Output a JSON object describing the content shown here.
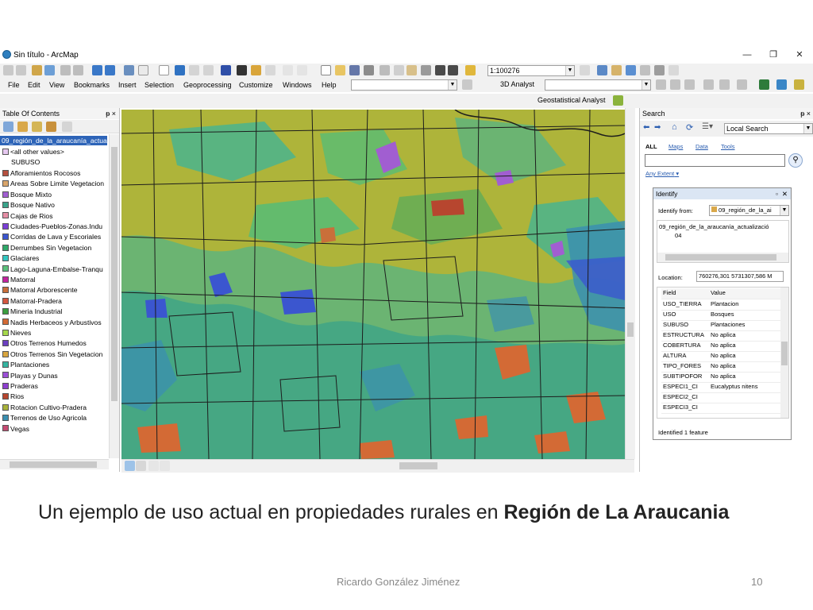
{
  "window": {
    "title": "Sin título - ArcMap",
    "minimize": "—",
    "restore": "❐",
    "close": "✕"
  },
  "toolbar": {
    "scale": "1:100276",
    "analyst_3d": "3D Analyst",
    "geostat": "Geostatistical Analyst"
  },
  "menu": [
    "File",
    "Edit",
    "View",
    "Bookmarks",
    "Insert",
    "Selection",
    "Geoprocessing",
    "Customize",
    "Windows",
    "Help"
  ],
  "toc": {
    "title": "Table Of Contents",
    "pin": "ᵽ ×",
    "layer": "09_región_de_la_araucanía_actual",
    "all_other": "<all other values>",
    "field": "SUBUSO",
    "classes": [
      {
        "label": "Afloramientos Rocosos",
        "color": "#b5503f"
      },
      {
        "label": "Areas Sobre Limite Vegetacion",
        "color": "#d9a56b"
      },
      {
        "label": "Bosque Mixto",
        "color": "#a15ed1"
      },
      {
        "label": "Bosque Nativo",
        "color": "#3aa38a"
      },
      {
        "label": "Cajas de Rios",
        "color": "#e58ea5"
      },
      {
        "label": "Ciudades-Pueblos-Zonas.Indu",
        "color": "#7a3fd6"
      },
      {
        "label": "Corridas de Lava y Escoriales",
        "color": "#3b56cf"
      },
      {
        "label": "Derrumbes Sin Vegetacion",
        "color": "#2fa86a"
      },
      {
        "label": "Glaciares",
        "color": "#33c6c0"
      },
      {
        "label": "Lago-Laguna-Embalse-Tranqu",
        "color": "#5bc07c"
      },
      {
        "label": "Matorral",
        "color": "#c3249e"
      },
      {
        "label": "Matorral Arborescente",
        "color": "#c96f3a"
      },
      {
        "label": "Matorral-Pradera",
        "color": "#d4563f"
      },
      {
        "label": "Mineria Industrial",
        "color": "#3a9e3f"
      },
      {
        "label": "Nadis Herbaceos y Arbustivos",
        "color": "#d36a35"
      },
      {
        "label": "Nieves",
        "color": "#a5d84a"
      },
      {
        "label": "Otros Terrenos Humedos",
        "color": "#6b3fc0"
      },
      {
        "label": "Otros Terrenos Sin Vegetacion",
        "color": "#d8a53f"
      },
      {
        "label": "Plantaciones",
        "color": "#35b4a0"
      },
      {
        "label": "Playas y Dunas",
        "color": "#9b4fd6"
      },
      {
        "label": "Praderas",
        "color": "#8e3fcf"
      },
      {
        "label": "Rios",
        "color": "#b7462f"
      },
      {
        "label": "Rotacion Cultivo-Pradera",
        "color": "#a8b23a"
      },
      {
        "label": "Terrenos de Uso Agricola",
        "color": "#3b8fb0"
      },
      {
        "label": "Vegas",
        "color": "#c54b72"
      }
    ]
  },
  "search": {
    "title": "Search",
    "pin": "ᵽ ×",
    "scope": "Local Search",
    "tabs": [
      "ALL",
      "Maps",
      "Data",
      "Tools"
    ],
    "any_extent": "Any Extent"
  },
  "identify": {
    "title": "Identify",
    "from_label": "Identify from:",
    "from_value": "09_región_de_la_ai",
    "tree_layer": "09_región_de_la_araucanía_actualizació",
    "tree_item": "04",
    "location_label": "Location:",
    "location_value": "760276,301  5731307,586 M",
    "col_field": "Field",
    "col_value": "Value",
    "rows": [
      {
        "field": "USO_TIERRA",
        "value": "Plantacion"
      },
      {
        "field": "USO",
        "value": "Bosques"
      },
      {
        "field": "SUBUSO",
        "value": "Plantaciones"
      },
      {
        "field": "ESTRUCTURA",
        "value": "No aplica"
      },
      {
        "field": "COBERTURA",
        "value": "No aplica"
      },
      {
        "field": "ALTURA",
        "value": "No aplica"
      },
      {
        "field": "TIPO_FORES",
        "value": "No aplica"
      },
      {
        "field": "SUBTIPOFOR",
        "value": "No aplica"
      },
      {
        "field": "ESPECI1_CI",
        "value": "Eucalyptus nitens"
      },
      {
        "field": "ESPECI2_CI",
        "value": ""
      },
      {
        "field": "ESPECI3_CI",
        "value": ""
      }
    ],
    "status": "Identified 1 feature"
  },
  "slide": {
    "caption_plain": "Un ejemplo de uso actual en propiedades rurales en ",
    "caption_bold": "Región de La Araucania",
    "author": "Ricardo González Jiménez",
    "page": "10"
  }
}
